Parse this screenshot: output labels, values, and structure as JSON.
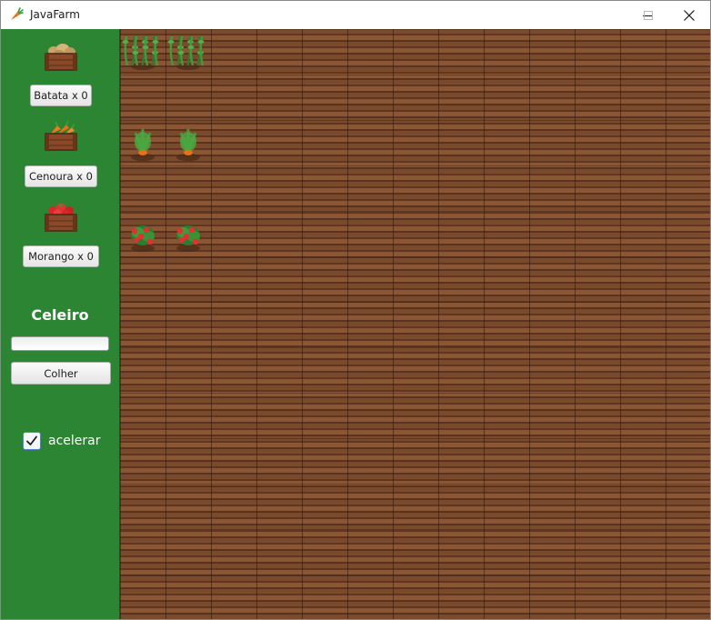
{
  "window": {
    "title": "JavaFarm",
    "icon": "carrot-icon",
    "controls": [
      "minimize-icon",
      "maximize-icon",
      "close-icon"
    ]
  },
  "sidebar": {
    "crops": [
      {
        "icon": "potato-crate-icon",
        "label": "Batata x 0"
      },
      {
        "icon": "carrot-crate-icon",
        "label": "Cenoura x 0"
      },
      {
        "icon": "strawberry-crate-icon",
        "label": "Morango x 0"
      }
    ],
    "barn_title": "Celeiro",
    "barn_progress": 0,
    "harvest_label": "Colher",
    "speedup_label": "acelerar",
    "speedup_checked": true
  },
  "field": {
    "columns": 13,
    "rows": 13,
    "plants": [
      {
        "crop": "potato",
        "row": 0,
        "col": 0
      },
      {
        "crop": "potato",
        "row": 0,
        "col": 1
      },
      {
        "crop": "carrot",
        "row": 2,
        "col": 0
      },
      {
        "crop": "carrot",
        "row": 2,
        "col": 1
      },
      {
        "crop": "strawberry",
        "row": 4,
        "col": 0
      },
      {
        "crop": "strawberry",
        "row": 4,
        "col": 1
      }
    ]
  },
  "colors": {
    "sidebar": "#2c8533",
    "soil": "#7a4a2c"
  }
}
